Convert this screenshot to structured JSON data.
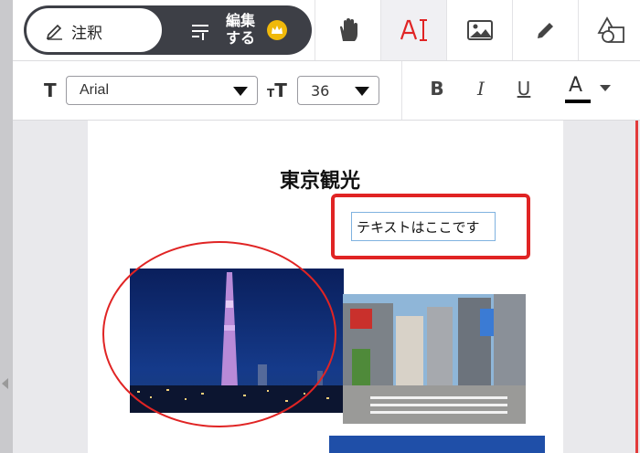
{
  "toolbar": {
    "annotate_label": "注釈",
    "edit_label_line1": "編集",
    "edit_label_line2": "する",
    "tools": [
      "hand-tool",
      "text-tool",
      "image-tool",
      "pen-tool",
      "shapes-tool"
    ],
    "active_tool": "text-tool",
    "accent_color": "#e02424"
  },
  "format": {
    "font_family": "Arial",
    "font_size": "36",
    "bold_label": "B",
    "italic_label": "I",
    "underline_label": "U",
    "color_label": "A",
    "text_color": "#000000"
  },
  "document": {
    "title": "東京観光",
    "textbox_text": "テキストはここです"
  }
}
